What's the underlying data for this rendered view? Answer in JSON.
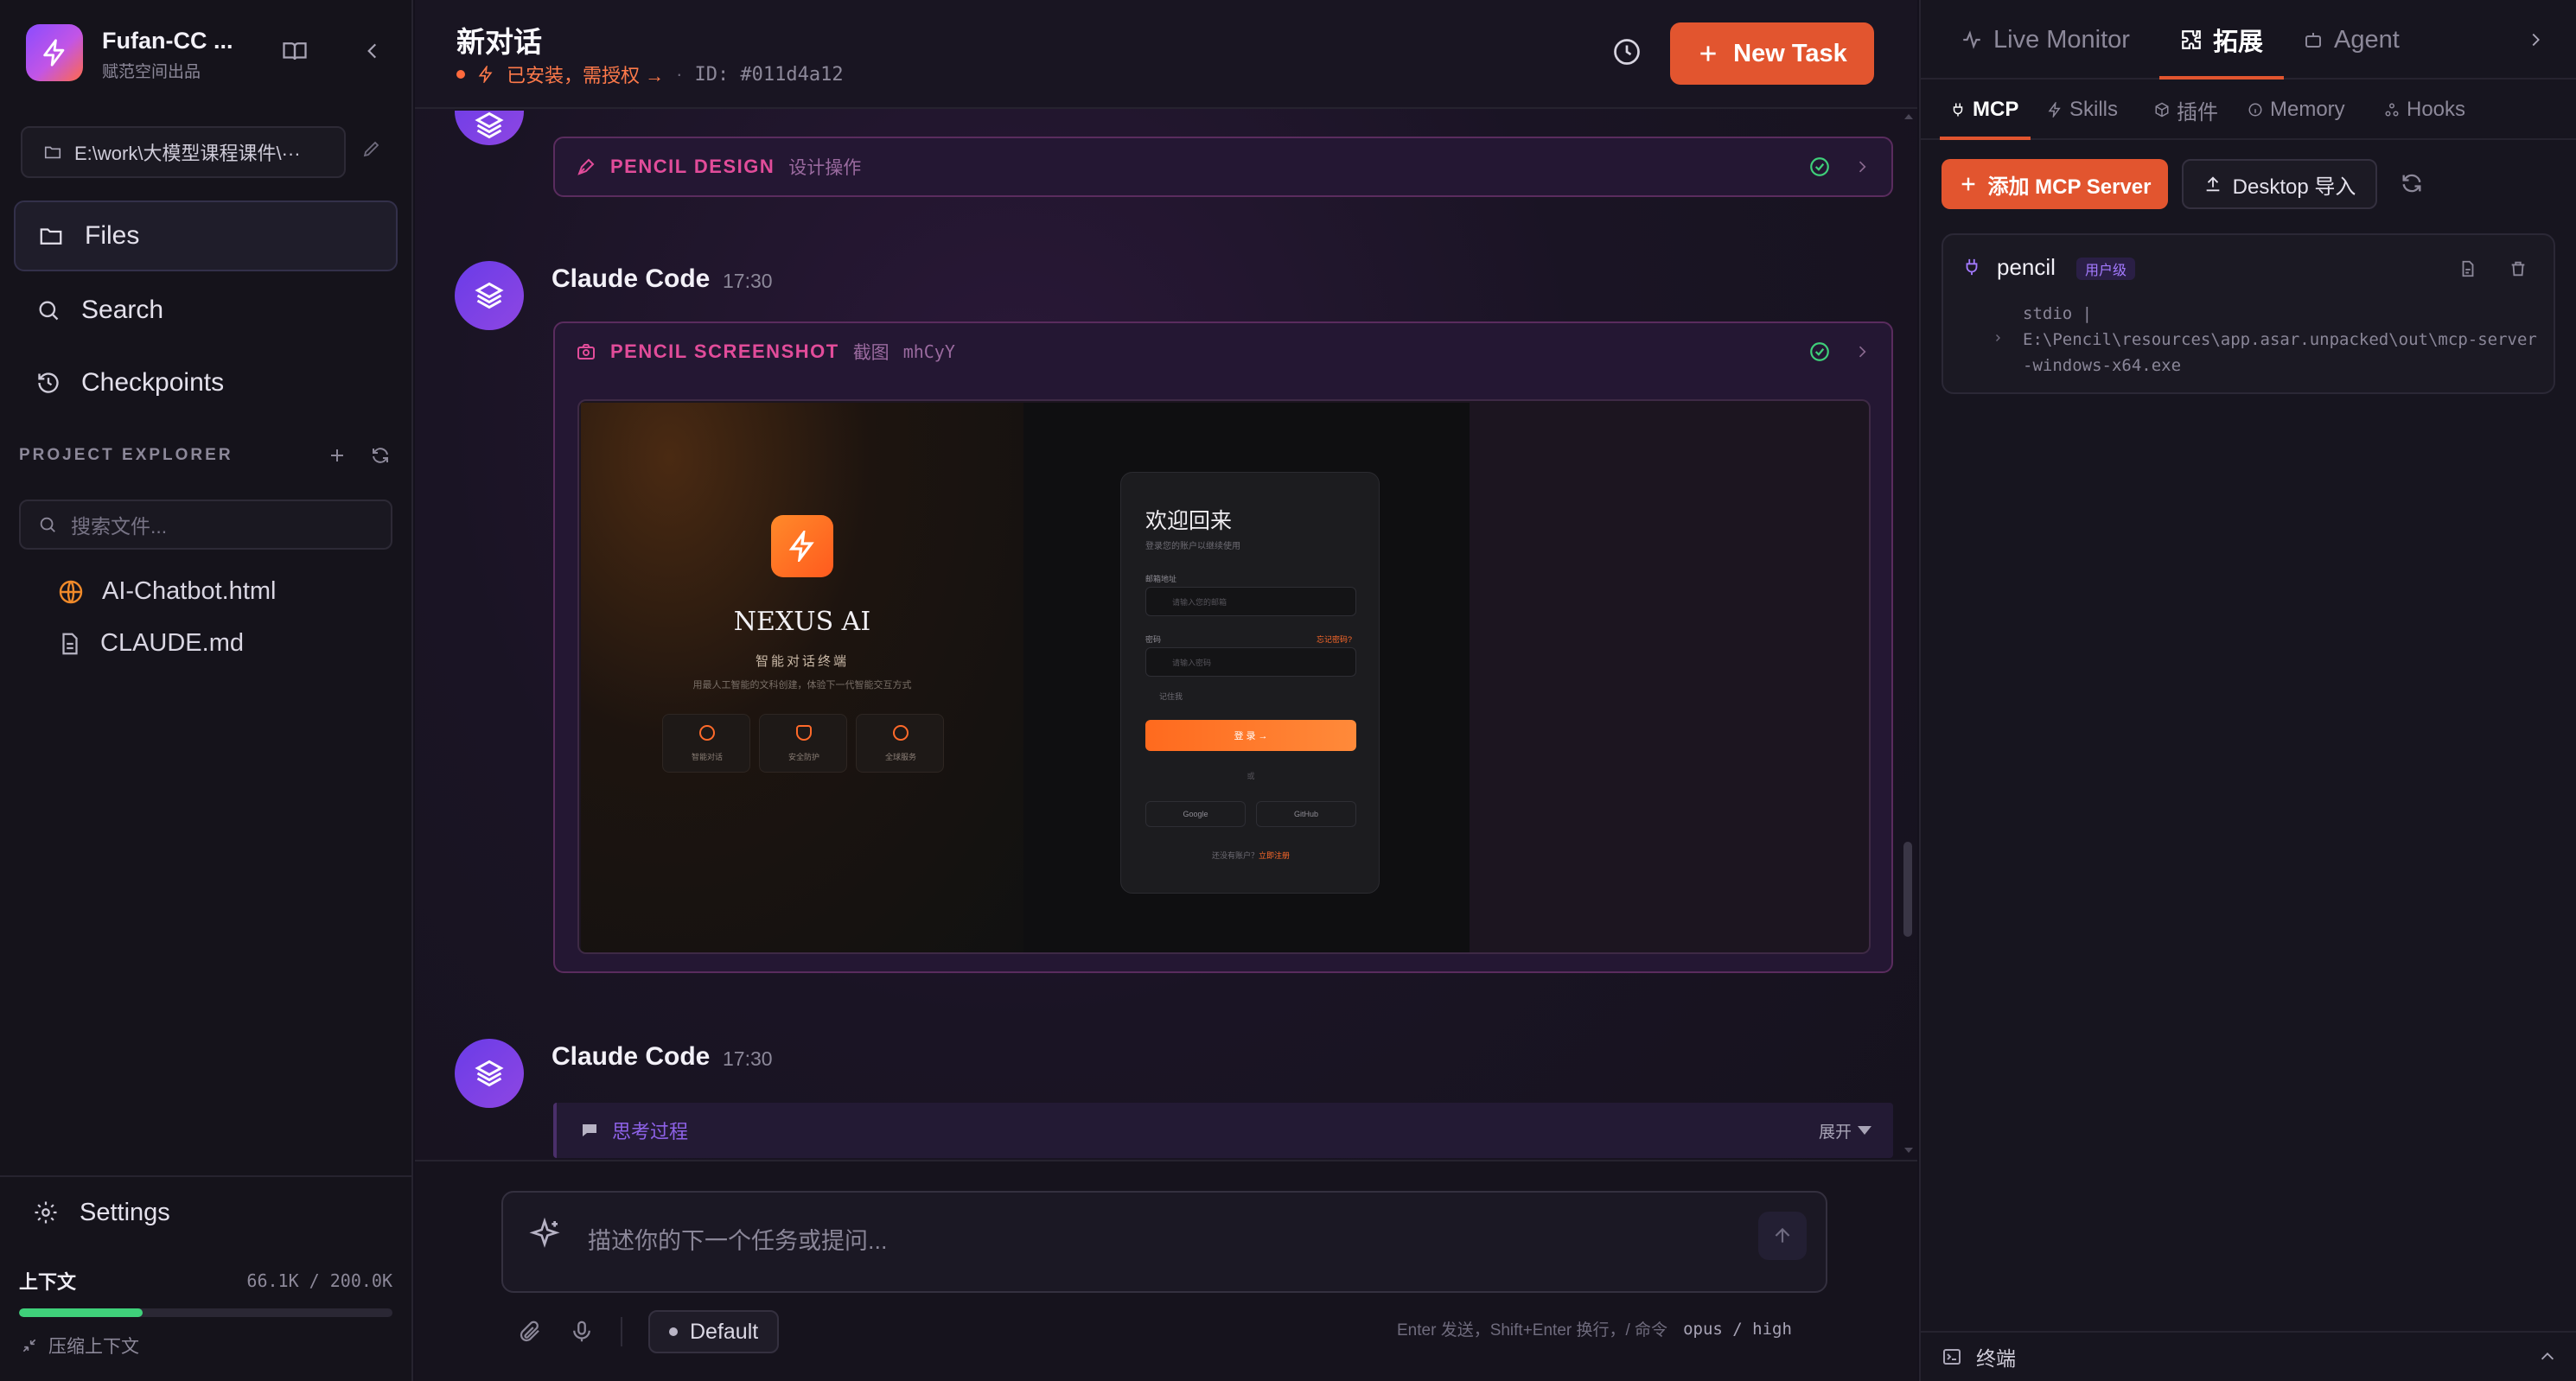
{
  "app": {
    "name": "Fufan-CC ...",
    "subtitle": "赋范空间出品"
  },
  "sidebar": {
    "path": "E:\\work\\大模型课程课件\\···",
    "nav": [
      {
        "label": "Files"
      },
      {
        "label": "Search"
      },
      {
        "label": "Checkpoints"
      }
    ],
    "explorer_title": "PROJECT EXPLORER",
    "file_search_placeholder": "搜索文件...",
    "files": [
      {
        "name": "AI-Chatbot.html"
      },
      {
        "name": "CLAUDE.md"
      }
    ],
    "settings_label": "Settings",
    "context": {
      "label": "上下文",
      "value": "66.1K / 200.0K",
      "fill": 0.33
    },
    "compress_label": "压缩上下文"
  },
  "chat": {
    "title": "新对话",
    "status": "已安装，需授权 →",
    "separator": "·",
    "id": "ID: #011d4a12",
    "new_task": "New Task",
    "messages": [
      {
        "tool": {
          "name": "PENCIL DESIGN",
          "desc": "设计操作"
        }
      },
      {
        "author": "Claude Code",
        "time": "17:30",
        "tool": {
          "name": "PENCIL SCREENSHOT",
          "desc": "截图",
          "id": "mhCyY"
        },
        "screenshot": {
          "brand": "NEXUS AI",
          "tagline": "智能对话终端",
          "desc": "用最人工智能的文科创建，体验下一代智能交互方式",
          "features": [
            "智能对话",
            "安全防护",
            "全球服务"
          ],
          "login": {
            "title": "欢迎回来",
            "subtitle": "登录您的账户以继续使用",
            "email_label": "邮箱地址",
            "email_placeholder": "请输入您的邮箱",
            "password_label": "密码",
            "forgot": "忘记密码?",
            "password_placeholder": "请输入密码",
            "remember": "记住我",
            "submit": "登 录 →",
            "or": "或",
            "google": "Google",
            "github": "GitHub",
            "footer": "还没有账户？",
            "footer_link": "立即注册"
          }
        }
      },
      {
        "author": "Claude Code",
        "time": "17:30",
        "thinking_label": "思考过程",
        "expand_label": "展开"
      }
    ],
    "composer": {
      "placeholder": "描述你的下一个任务或提问...",
      "mode": "Default",
      "hint": "Enter 发送，Shift+Enter 换行，/ 命令",
      "model": "opus / high"
    }
  },
  "right": {
    "tabs": [
      {
        "label": "Live Monitor"
      },
      {
        "label": "拓展"
      },
      {
        "label": "Agent"
      }
    ],
    "subtabs": [
      {
        "label": "MCP"
      },
      {
        "label": "Skills"
      },
      {
        "label": "插件"
      },
      {
        "label": "Memory"
      },
      {
        "label": "Hooks"
      }
    ],
    "add_button": "添加 MCP Server",
    "import_button": "Desktop 导入",
    "server": {
      "name": "pencil",
      "badge": "用户级",
      "command": "stdio |",
      "path": "E:\\Pencil\\resources\\app.asar.unpacked\\out\\mcp-server-windows-x64.exe"
    },
    "terminal_label": "终端"
  },
  "colors": {
    "accent": "#e2552f",
    "tool_pink": "#e24c9a",
    "avatar": "#6a3ce8",
    "success": "#3fd07a"
  }
}
